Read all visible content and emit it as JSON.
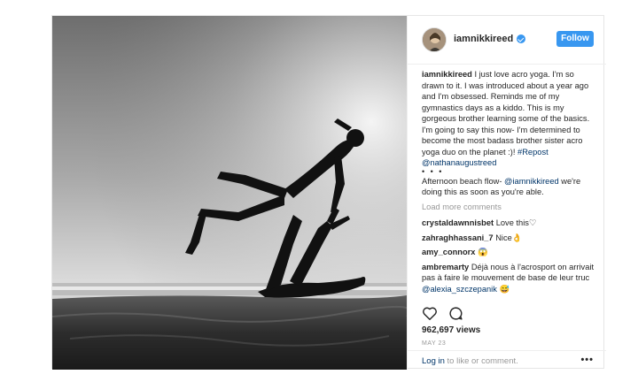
{
  "post": {
    "username": "iamnikkireed",
    "follow_label": "Follow",
    "caption": {
      "author": "iamnikkireed",
      "text": "I just love acro yoga. I'm so drawn to it. I was introduced about a year ago and I'm obsessed. Reminds me of my gymnastics days as a kiddo. This is my gorgeous brother learning some of the basics. I'm going to say this now- I'm determined to become the most badass brother sister acro yoga duo on the planet :)!",
      "hashtag": "#Repost",
      "mention": "@nathanaugustreed",
      "dots": "• • •",
      "text2_pre": "Afternoon beach flow-",
      "mention2": "@iamnikkireed",
      "text2_post": "we're doing this as soon as you're able."
    },
    "load_more": "Load more comments",
    "comments": [
      {
        "user": "crystaldawnnisbet",
        "text": "Love this♡",
        "mention": "",
        "tail": ""
      },
      {
        "user": "zahraghhassani_7",
        "text": "Nice👌",
        "mention": "",
        "tail": ""
      },
      {
        "user": "amy_connorx",
        "text": "😱",
        "mention": "",
        "tail": ""
      },
      {
        "user": "ambremarty",
        "text": "Déjà nous à l'acrosport on arrivait pas à faire le mouvement de base de leur truc",
        "mention": "@alexia_szczepanik",
        "tail": "😅"
      }
    ],
    "views": "962,697 views",
    "date": "MAY 23",
    "login_link": "Log in",
    "login_rest": "to like or comment.",
    "more": "•••"
  }
}
